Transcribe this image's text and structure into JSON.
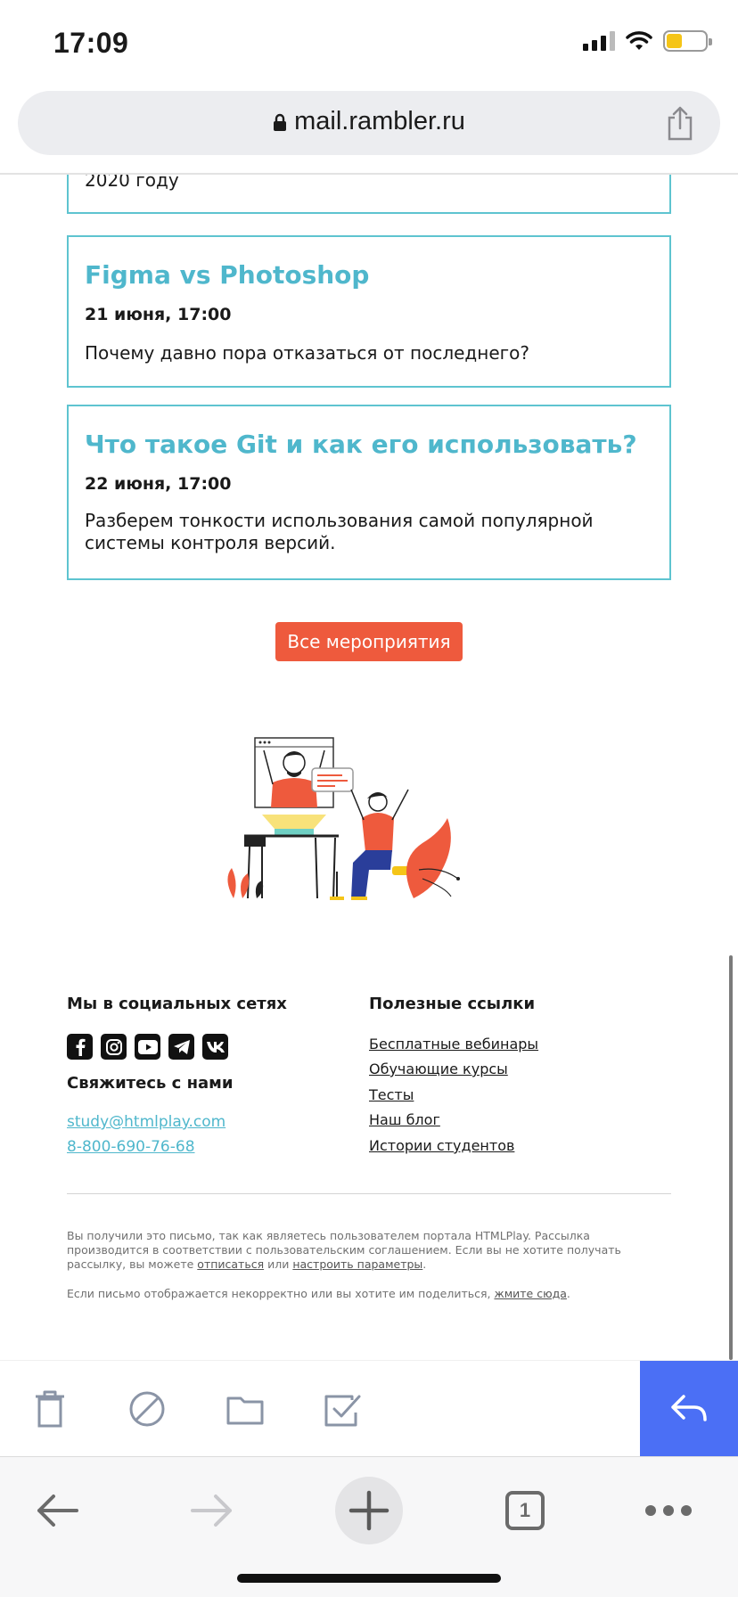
{
  "status_bar": {
    "time": "17:09"
  },
  "browser": {
    "url": "mail.rambler.ru",
    "tab_count": "1"
  },
  "events": {
    "partial_text": "2020 году",
    "items": [
      {
        "title": "Figma vs Photoshop",
        "date": "21 июня, 17:00",
        "description": "Почему давно пора отказаться от последнего?"
      },
      {
        "title": "Что такое Git и как его использовать?",
        "date": "22 июня, 17:00",
        "description": "Разберем тонкости использования самой популярной системы контроля версий."
      }
    ],
    "all_events_label": "Все мероприятия"
  },
  "footer": {
    "social_heading": "Мы в социальных сетях",
    "social_icons": [
      "facebook-icon",
      "instagram-icon",
      "youtube-icon",
      "telegram-icon",
      "vk-icon"
    ],
    "contact_heading": "Свяжитесь с нами",
    "email": "study@htmlplay.com",
    "phone": "8-800-690-76-68",
    "links_heading": "Полезные ссылки",
    "links": [
      "Бесплатные вебинары",
      "Обучающие курсы",
      "Тесты",
      "Наш блог",
      "Истории студентов"
    ],
    "legal": {
      "line1": "Вы получили это письмо, так как являетесь пользователем портала HTMLPlay. Рассылка производится в соответствии с пользовательским соглашением. Если вы не хотите получать рассылку, вы можете",
      "unsubscribe": "отписаться",
      "or": "или",
      "settings": "настроить параметры",
      "period": ".",
      "line2": "Если письмо отображается некорректно или вы хотите им поделиться,",
      "click_here": "жмите сюда",
      "period2": "."
    }
  },
  "colors": {
    "accent_teal": "#4fb7cc",
    "button_orange": "#ee5a3d",
    "reply_blue": "#4b6ff5"
  }
}
